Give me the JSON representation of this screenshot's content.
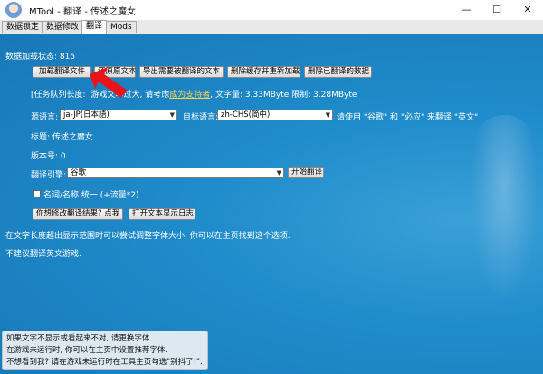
{
  "window": {
    "title": "MTool - 翻译 - 传述之魔女",
    "minimize": "—",
    "maximize": "☐",
    "close": "✕"
  },
  "tabs": [
    {
      "label": "数据锁定"
    },
    {
      "label": "数据修改"
    },
    {
      "label": "翻译"
    },
    {
      "label": "Mods"
    }
  ],
  "main": {
    "status": "数据加载状态: 815",
    "buttons": {
      "load": "加载翻译文件",
      "restore": "还原原文本",
      "export": "导出需要被翻译的文本",
      "clear_cache": "删除缓存并重新加载",
      "delete_data": "删除已翻译的数据"
    },
    "notice_prefix": "[任务队列长度:",
    "notice_mid": "游戏文本过大, 请考虑",
    "notice_link": "成为支持者",
    "notice_suffix": ", 文字量: 3.33MByte 限制: 3.28MByte",
    "source_lang_label": "源语言:",
    "source_lang_value": "ja-JP(日本語)",
    "target_lang_label": "目标语言:",
    "target_lang_value": "zh-CHS(简中)",
    "lang_hint": "请使用 \"谷歌\" 和 \"必应\" 来翻译 \"英文\"",
    "title_line": "标题: 传述之魔女",
    "version_line": "版本号: 0",
    "engine_label": "翻译引擎:",
    "engine_value": "谷歌",
    "start_button": "开始翻译",
    "name_checkbox_label": "名词/名称 统一 (+流量*2)",
    "modify_button": "你想修改翻译结果? 点我",
    "open_log_button": "打开文本显示日志",
    "font_hint": "在文字长度超出显示范围时可以尝试调整字体大小, 你可以在主页找到这个选项.",
    "english_hint": "不建议翻译英文游戏."
  },
  "tip": {
    "line1": "如果文字不显示或看起来不对, 请更换字体.",
    "line2": "在游戏未运行时, 你可以在主页中设置推荐字体.",
    "line3": "不想看到我? 请在游戏未运行时在工具主页勾选\"别抖了!\"."
  },
  "colors": {
    "background": "#1d87c6",
    "link": "#ffd84a",
    "arrow": "#e8141a"
  },
  "icons": {
    "app": "mtool-avatar-icon",
    "pointer": "red-arrow-icon"
  }
}
